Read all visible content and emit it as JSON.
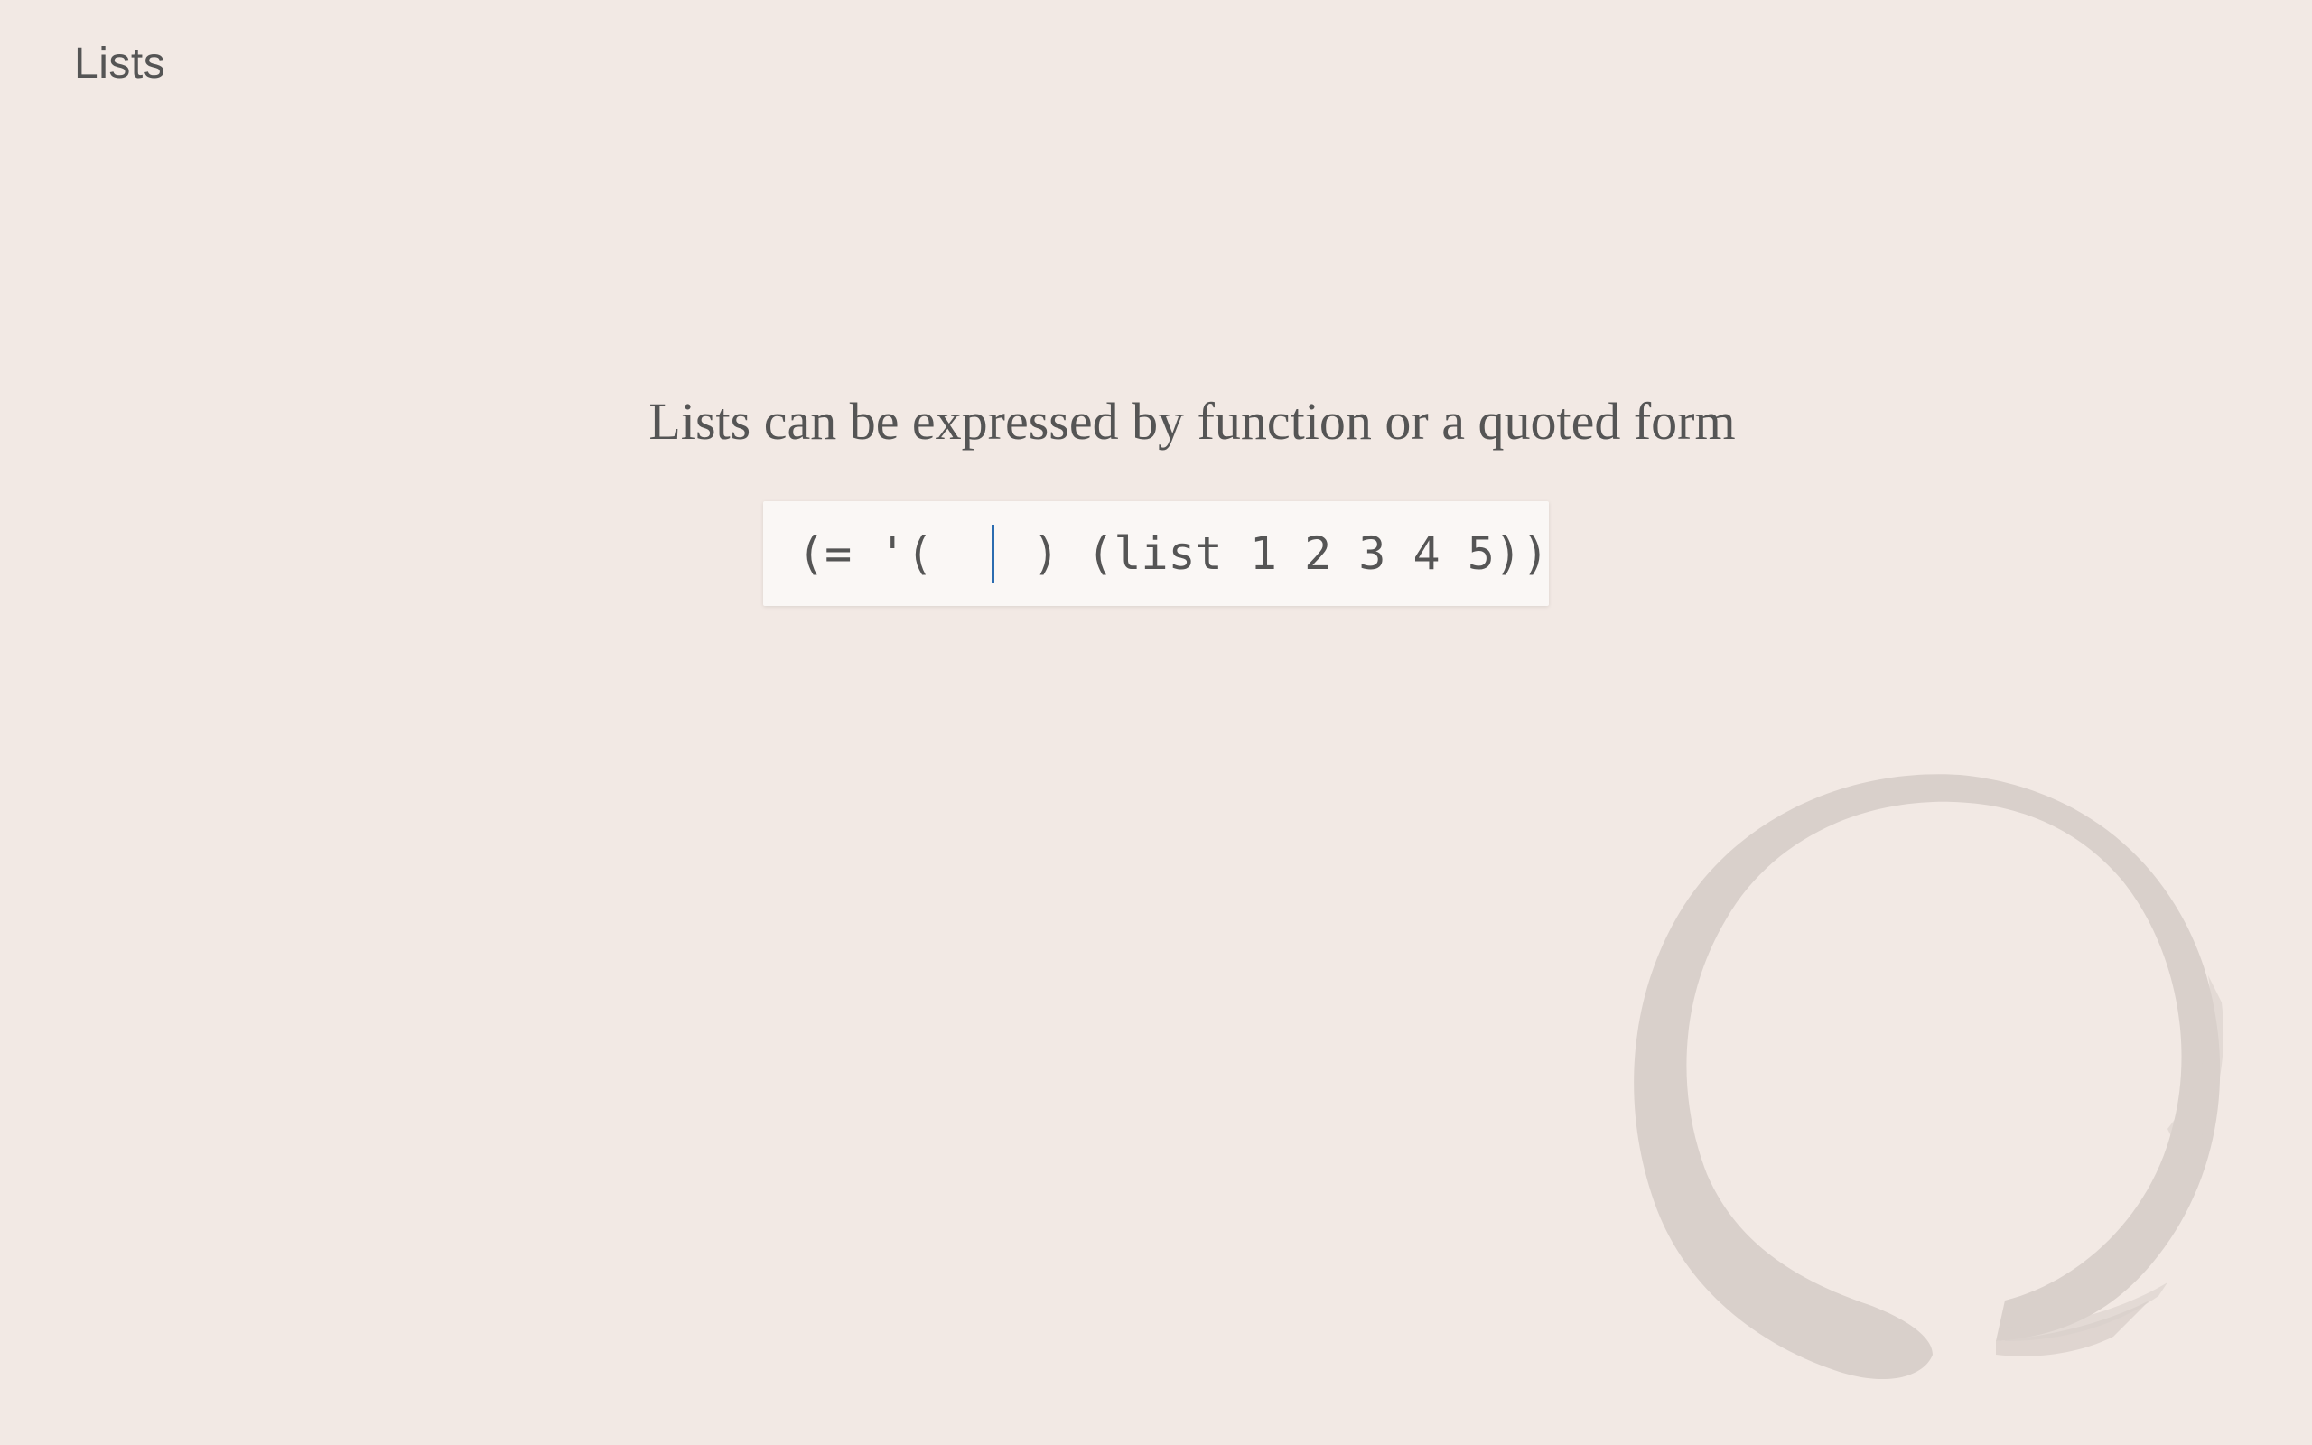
{
  "page": {
    "title": "Lists",
    "prompt": "Lists can be expressed by function or a quoted form"
  },
  "exercise": {
    "code_before": "(= '(",
    "input_value": "",
    "code_after": ") (list 1 2 3 4 5))"
  },
  "decoration": {
    "icon": "enso-circle-icon"
  },
  "colors": {
    "background": "#f2e9e4",
    "text": "#555555",
    "code_box": "#faf7f5",
    "caret": "#2b6cb0",
    "enso": "#d9d0cb"
  }
}
